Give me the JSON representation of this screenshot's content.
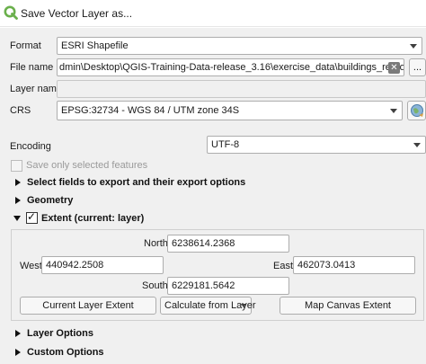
{
  "window": {
    "title": "Save Vector Layer as...",
    "icon": "qgis-logo-icon",
    "accent": "#6ab04c"
  },
  "format": {
    "label": "Format",
    "value": "ESRI Shapefile"
  },
  "file_name": {
    "label": "File name",
    "value": "dmin\\Desktop\\QGIS-Training-Data-release_3.16\\exercise_data\\buildings_reprojected.shp",
    "browse_label": "..."
  },
  "layer_name": {
    "label": "Layer name",
    "value": ""
  },
  "crs": {
    "label": "CRS",
    "value": "EPSG:32734 - WGS 84 / UTM zone 34S"
  },
  "encoding": {
    "label": "Encoding",
    "value": "UTF-8"
  },
  "save_selected": {
    "label": "Save only selected features",
    "checked": false
  },
  "sections": {
    "fields": "Select fields to export and their export options",
    "geometry": "Geometry",
    "extent": "Extent (current: layer)",
    "layer_options": "Layer Options",
    "custom_options": "Custom Options"
  },
  "extent": {
    "checked": true,
    "north_label": "North",
    "north_value": "6238614.2368",
    "west_label": "West",
    "west_value": "440942.2508",
    "east_label": "East",
    "east_value": "462073.0413",
    "south_label": "South",
    "south_value": "6229181.5642",
    "current_layer_btn": "Current Layer Extent",
    "calculate_btn": "Calculate from Layer",
    "map_canvas_btn": "Map Canvas Extent"
  }
}
